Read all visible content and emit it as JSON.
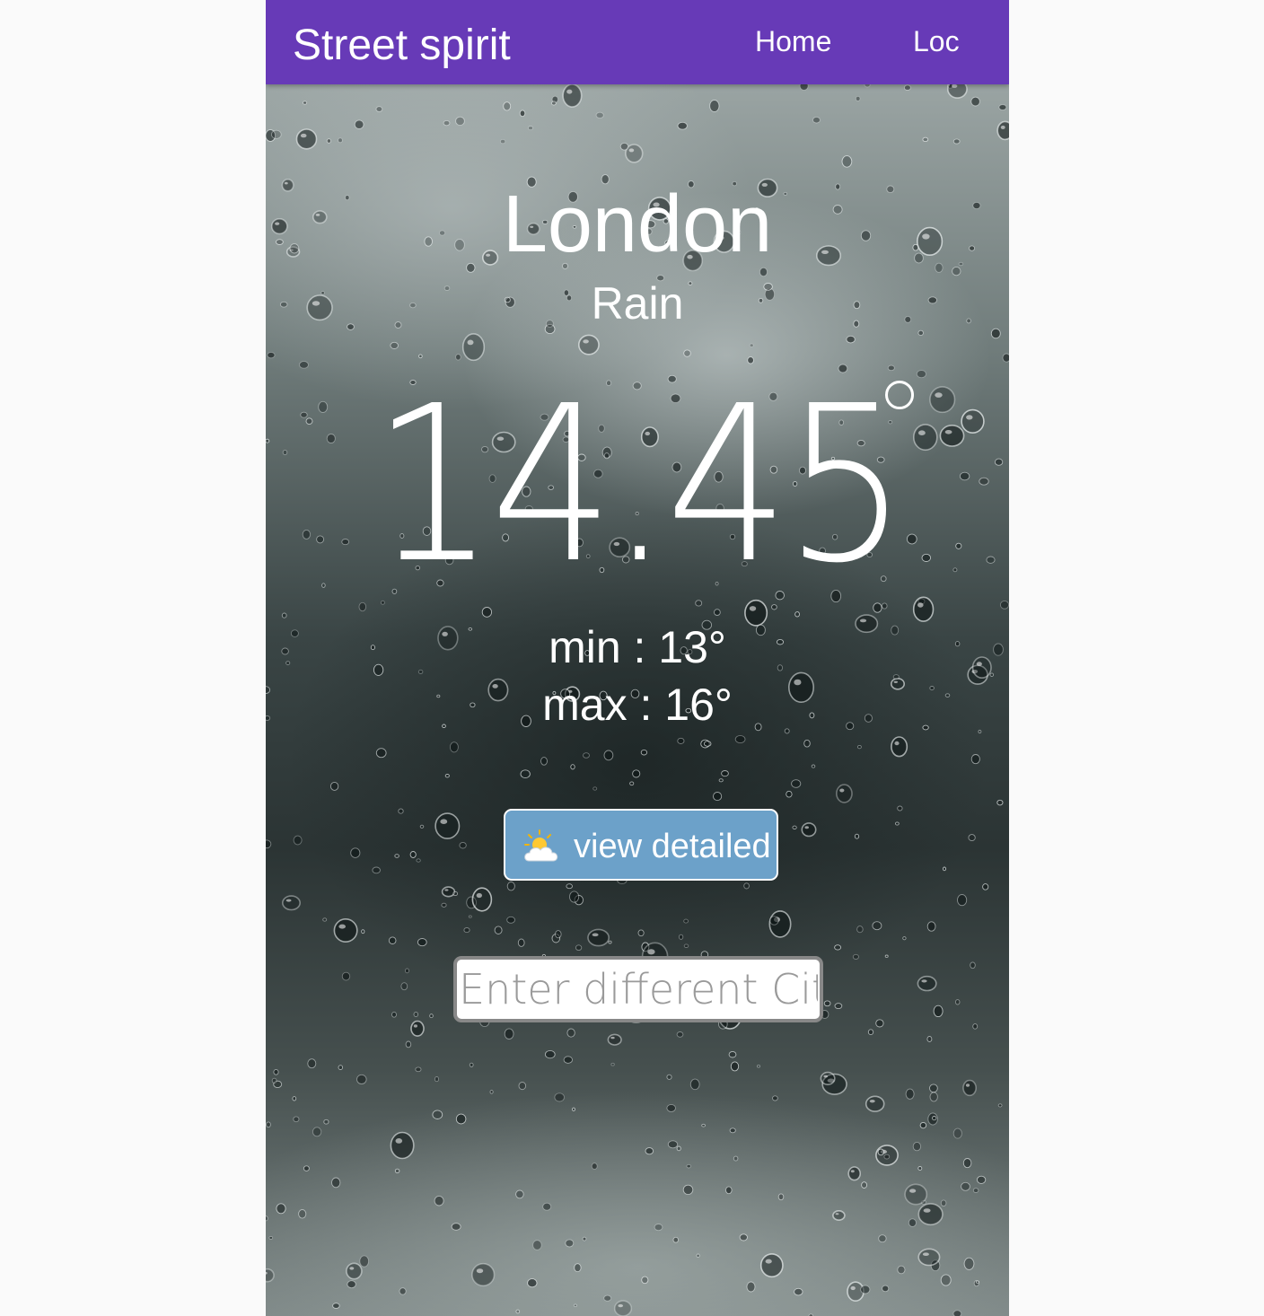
{
  "navbar": {
    "brand": "Street spirit",
    "links": [
      "Home",
      "Loc"
    ],
    "color": "#673ab7"
  },
  "weather": {
    "city": "London",
    "condition": "Rain",
    "temperature": "14.45",
    "min_label": "min : 13°",
    "max_label": "max : 16°"
  },
  "actions": {
    "detail_button_label": "view detailed",
    "detail_button_icon": "sun-behind-cloud-icon",
    "detail_button_color": "#6ca1c9",
    "city_input_placeholder": "Enter different City",
    "city_input_value": ""
  },
  "background": {
    "description_icon": "rain-on-glass-image"
  }
}
